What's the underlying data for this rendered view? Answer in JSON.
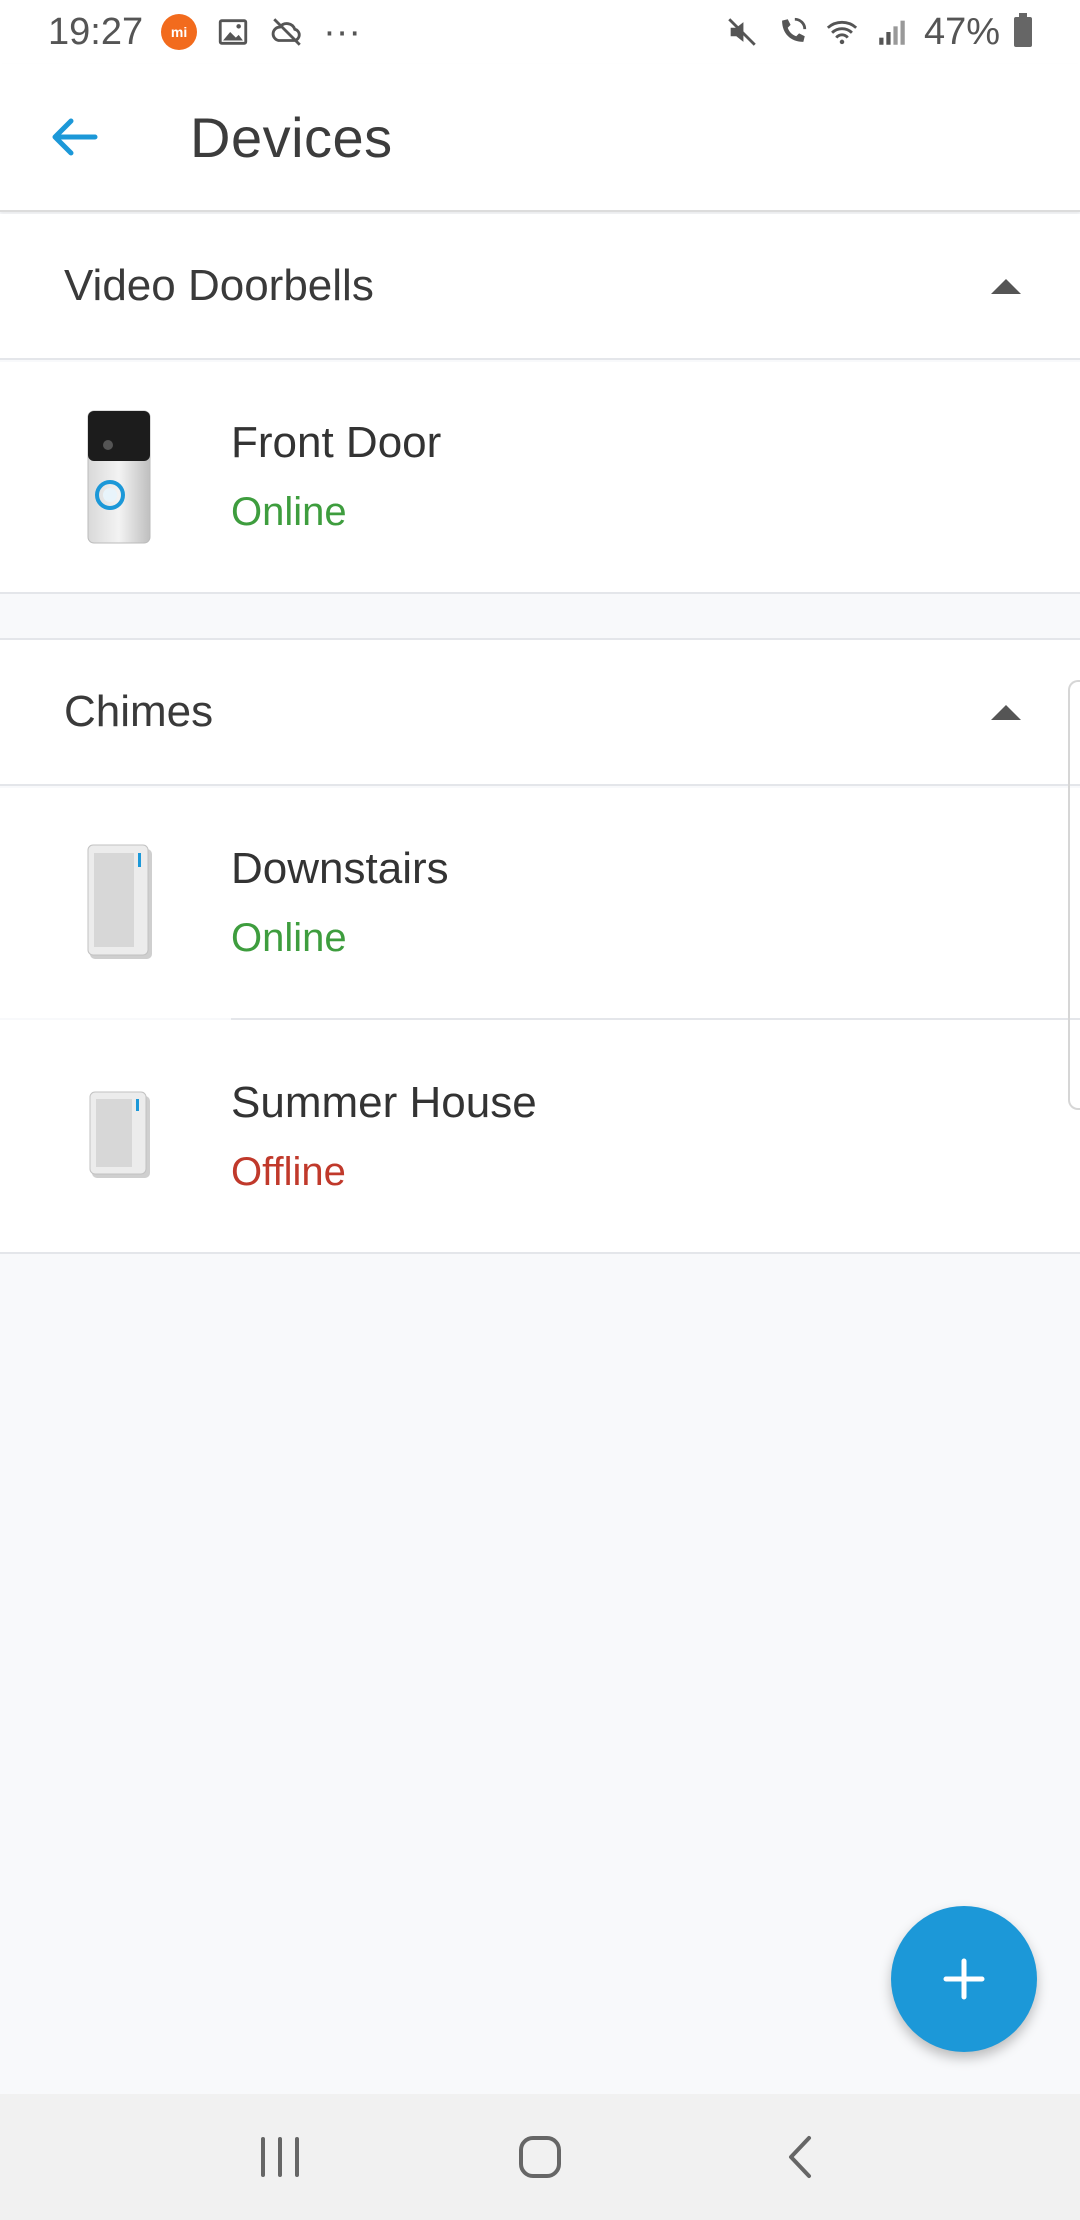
{
  "status_bar": {
    "time": "19:27",
    "mi_badge": "mi",
    "more": "···",
    "battery": "47%",
    "icons": [
      "mi-notification-icon",
      "image-icon",
      "cloud-off-icon",
      "mute-icon",
      "wifi-call-icon",
      "wifi-icon",
      "signal-icon",
      "battery-icon"
    ]
  },
  "header": {
    "title": "Devices",
    "back_icon": "arrow-left-icon"
  },
  "sections": [
    {
      "title": "Video Doorbells",
      "devices": [
        {
          "name": "Front Door",
          "status": "Online"
        }
      ]
    },
    {
      "title": "Chimes",
      "devices": [
        {
          "name": "Downstairs",
          "status": "Online"
        },
        {
          "name": "Summer House",
          "status": "Offline"
        }
      ]
    }
  ],
  "fab": {
    "icon": "plus-icon"
  },
  "nav": {
    "icons": [
      "recent-apps-icon",
      "home-icon",
      "back-icon"
    ]
  },
  "colors": {
    "accent": "#1c98d8",
    "online": "#3e9d3e",
    "offline": "#c0392b",
    "background": "#f8f9fb"
  }
}
